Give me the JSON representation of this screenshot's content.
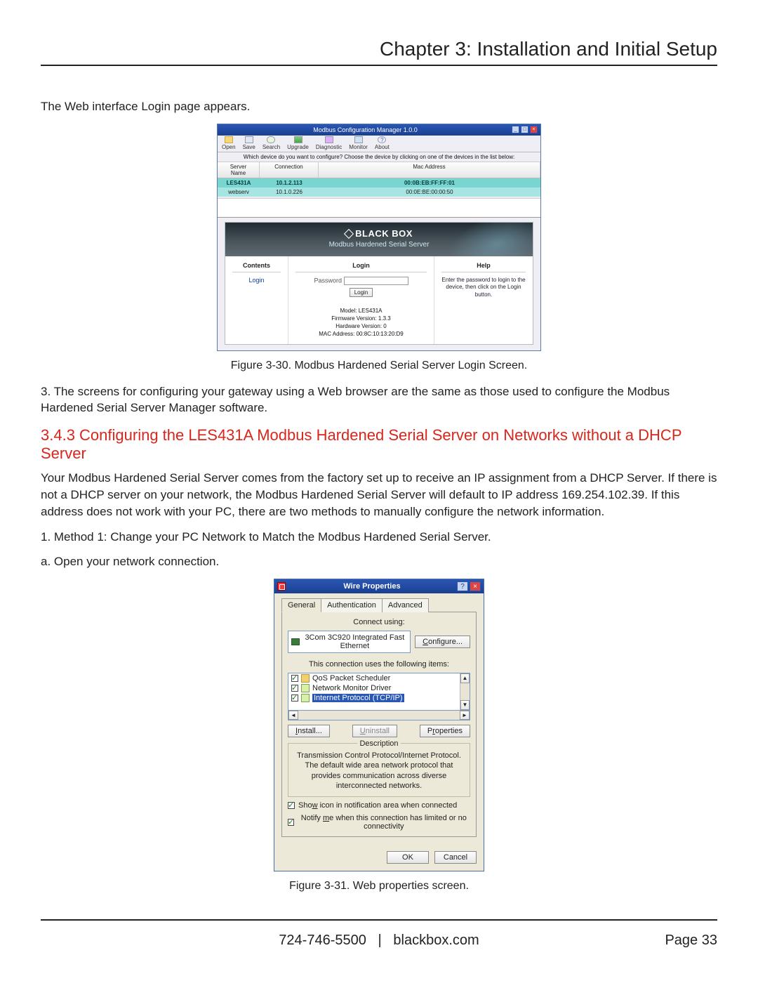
{
  "chapter_title": "Chapter 3: Installation and Initial Setup",
  "intro_text": "The Web interface Login page appears.",
  "fig30": {
    "caption": "Figure 3-30. Modbus Hardened Serial Server Login Screen.",
    "window_title": "Modbus Configuration Manager 1.0.0",
    "toolbar": [
      "Open",
      "Save",
      "Search",
      "Upgrade",
      "Diagnostic",
      "Monitor",
      "About"
    ],
    "hint": "Which device do you want to configure? Choose the device by clicking on one of the devices in the list below:",
    "columns": [
      "Server Name",
      "Connection",
      "Mac Address"
    ],
    "rows": [
      {
        "name": "LES431A",
        "conn": "10.1.2.113",
        "mac": "00:0B:EB:FF:FF:01"
      },
      {
        "name": "webserv",
        "conn": "10.1.0.226",
        "mac": "00:0E:BE:00:00:50"
      }
    ],
    "brand": "BLACK BOX",
    "brand_sub": "Modbus Hardened Serial Server",
    "contents_heading": "Contents",
    "contents_link": "Login",
    "login_heading": "Login",
    "password_label": "Password",
    "login_button": "Login",
    "info_model": "Model: LES431A",
    "info_fw": "Firmware Version: 1.3.3",
    "info_hw": "Hardware Version: 0",
    "info_mac": "MAC Address: 00:8C:10:13:20:D9",
    "help_heading": "Help",
    "help_text": "Enter the password to login to the device, then click on the Login button."
  },
  "step3": "3. The screens for configuring your gateway using a Web browser are the same as those used to configure the Modbus Hardened Serial Server Manager software.",
  "section_heading": "3.4.3 Configuring the LES431A Modbus Hardened Serial Server on Networks without a DHCP Server",
  "section_p1": "Your Modbus Hardened Serial Server comes from the factory set up to receive an IP assignment from a DHCP Server. If there is not a DHCP server on your network, the Modbus Hardened Serial Server will default to IP address 169.254.102.39. If this address does not work with your PC, there are two methods to manually configure the network information.",
  "method1": "1. Method 1: Change your PC Network to Match the Modbus Hardened Serial Server.",
  "step_a": "a. Open your network connection.",
  "fig31": {
    "caption": "Figure 3-31. Web properties screen.",
    "window_title": "Wire Properties",
    "tabs": [
      "General",
      "Authentication",
      "Advanced"
    ],
    "connect_using": "Connect using:",
    "adapter": "3Com 3C920 Integrated Fast Ethernet",
    "configure": "Configure...",
    "uses_items": "This connection uses the following items:",
    "items": [
      "QoS Packet Scheduler",
      "Network Monitor Driver",
      "Internet Protocol (TCP/IP)"
    ],
    "install": "Install...",
    "uninstall": "Uninstall",
    "properties": "Properties",
    "description_label": "Description",
    "description_text": "Transmission Control Protocol/Internet Protocol. The default wide area network protocol that provides communication across diverse interconnected networks.",
    "chk_showicon": "Show icon in notification area when connected",
    "chk_notify": "Notify me when this connection has limited or no connectivity",
    "ok": "OK",
    "cancel": "Cancel"
  },
  "footer": {
    "phone": "724-746-5500",
    "sep": "|",
    "site": "blackbox.com",
    "page_label": "Page",
    "page_num": "33"
  }
}
